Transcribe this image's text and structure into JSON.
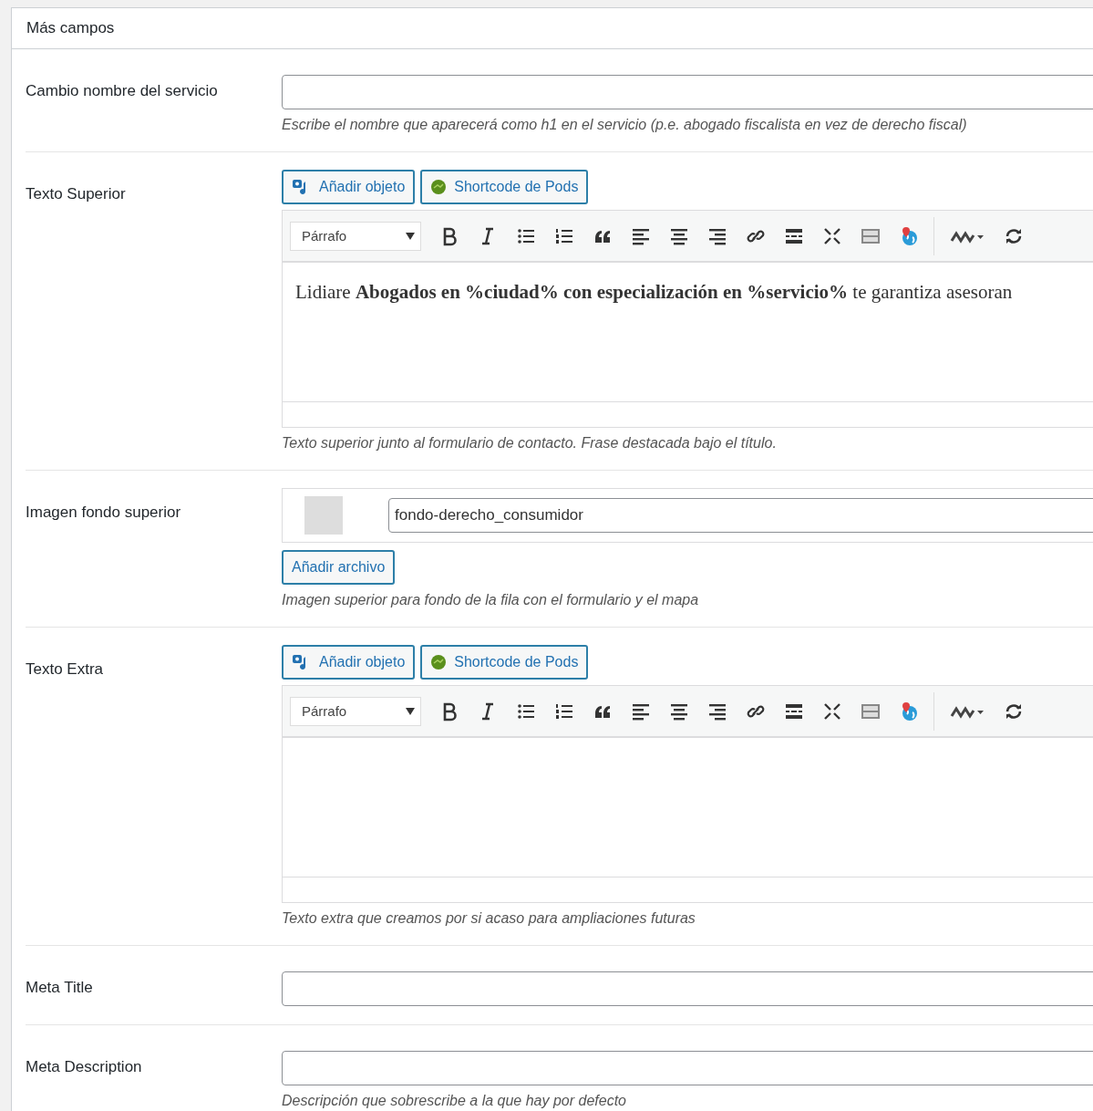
{
  "panel": {
    "title": "Más campos"
  },
  "fields": [
    {
      "kind": "text",
      "label": "Cambio nombre del servicio",
      "description": "Escribe el nombre que aparecerá como h1 en el servicio (p.e. abogado fiscalista en vez de derecho fiscal)"
    },
    {
      "kind": "editor",
      "label": "Texto Superior",
      "media_buttons": [
        "Añadir objeto",
        "Shortcode de Pods"
      ],
      "format": "Párrafo",
      "content": "Lidiare **Abogados en %ciudad% con especialización en %servicio%** te garantiza asesoran",
      "description": "Texto superior junto al formulario de contacto. Frase destacada bajo el título."
    },
    {
      "kind": "file",
      "label": "Imagen fondo superior",
      "filename": "fondo-derecho_consumidor",
      "button": "Añadir archivo",
      "description": "Imagen superior para fondo de la fila con el formulario y el mapa"
    },
    {
      "kind": "editor",
      "label": "Texto Extra",
      "media_buttons": [
        "Añadir objeto",
        "Shortcode de Pods"
      ],
      "format": "Párrafo",
      "description": "Texto extra que creamos por si acaso para ampliaciones futuras"
    },
    {
      "kind": "text",
      "label": "Meta Title"
    },
    {
      "kind": "text",
      "label": "Meta Description",
      "description": "Descripción que sobrescribe a la que hay por defecto"
    }
  ]
}
